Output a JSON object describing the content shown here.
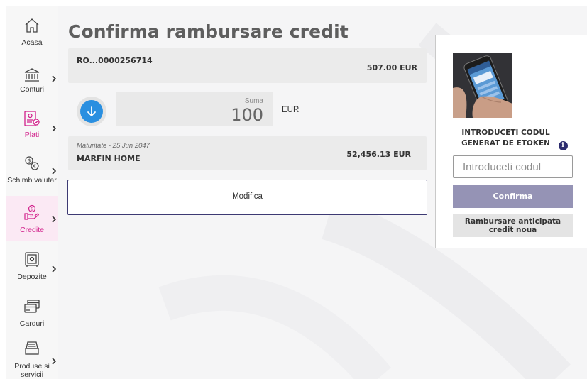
{
  "sidebar": {
    "items": [
      {
        "label": "Acasa",
        "icon": "home-icon"
      },
      {
        "label": "Conturi",
        "icon": "bank-icon"
      },
      {
        "label": "Plati",
        "icon": "payment-icon"
      },
      {
        "label": "Schimb valutar",
        "icon": "currency-exchange-icon"
      },
      {
        "label": "Credite",
        "icon": "credit-icon"
      },
      {
        "label": "Depozite",
        "icon": "safe-icon"
      },
      {
        "label": "Carduri",
        "icon": "card-icon"
      },
      {
        "label": "Produse si servicii",
        "icon": "products-icon"
      }
    ],
    "active_label_color": "#d11f8a"
  },
  "page": {
    "title": "Confirma rambursare credit"
  },
  "account": {
    "number": "RO...0000256714",
    "balance": "507.00 EUR"
  },
  "amount": {
    "label": "Suma",
    "value": "100",
    "currency": "EUR"
  },
  "loan": {
    "maturity": "Maturitate - 25 Jun 2047",
    "name": "MARFIN HOME",
    "balance": "52,456.13 EUR"
  },
  "actions": {
    "modify_label": "Modifica"
  },
  "etoken": {
    "instruction": "INTRODUCETI CODUL GENERAT DE ETOKEN",
    "info_icon_text": "i",
    "input_placeholder": "Introduceti codul",
    "confirm_label": "Confirma",
    "new_credit_label": "Rambursare anticipata credit noua"
  },
  "colors": {
    "accent_blue": "#2a8fe0",
    "brand_navy": "#3d3a73",
    "confirm_button": "#9593b5"
  }
}
